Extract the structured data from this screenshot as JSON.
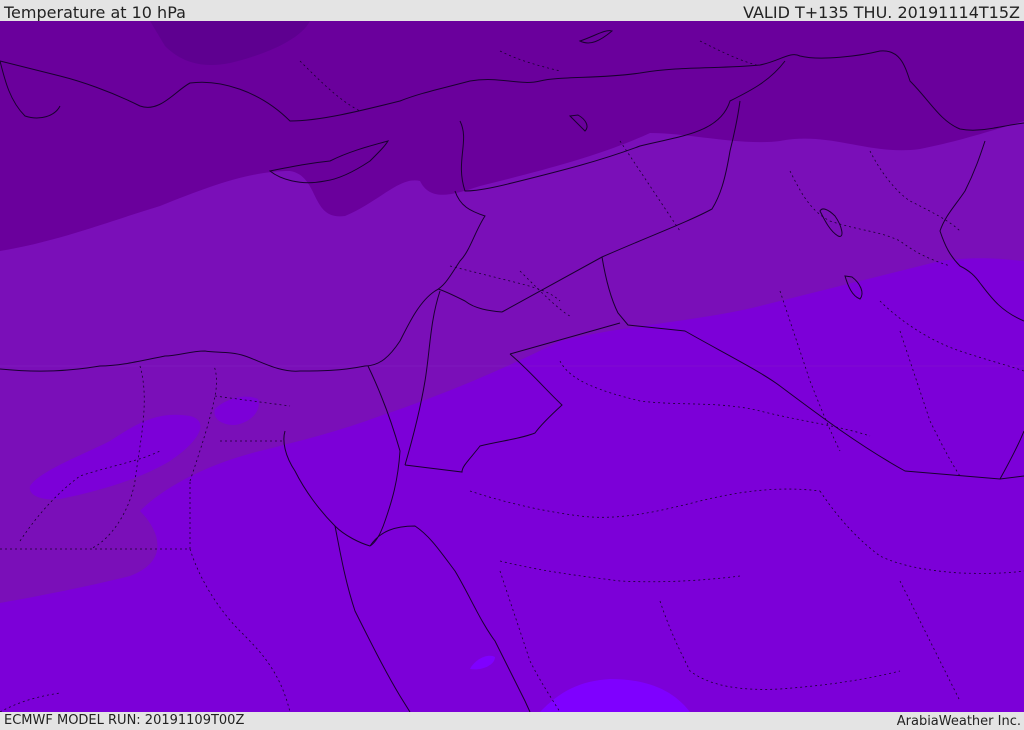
{
  "header": {
    "title": "Temperature at 10 hPa",
    "valid": "VALID T+135 THU. 20191114T15Z"
  },
  "footer": {
    "model_run": "ECMWF MODEL RUN: 20191109T00Z",
    "brand": "ArabiaWeather Inc."
  },
  "colors": {
    "band_coldest": "#5e0090",
    "band_cold": "#6b009e",
    "band_mid": "#7a0fb8",
    "band_warm": "#7c00d8",
    "band_warmest": "#7f00ff",
    "border_line": "#1a0030"
  }
}
